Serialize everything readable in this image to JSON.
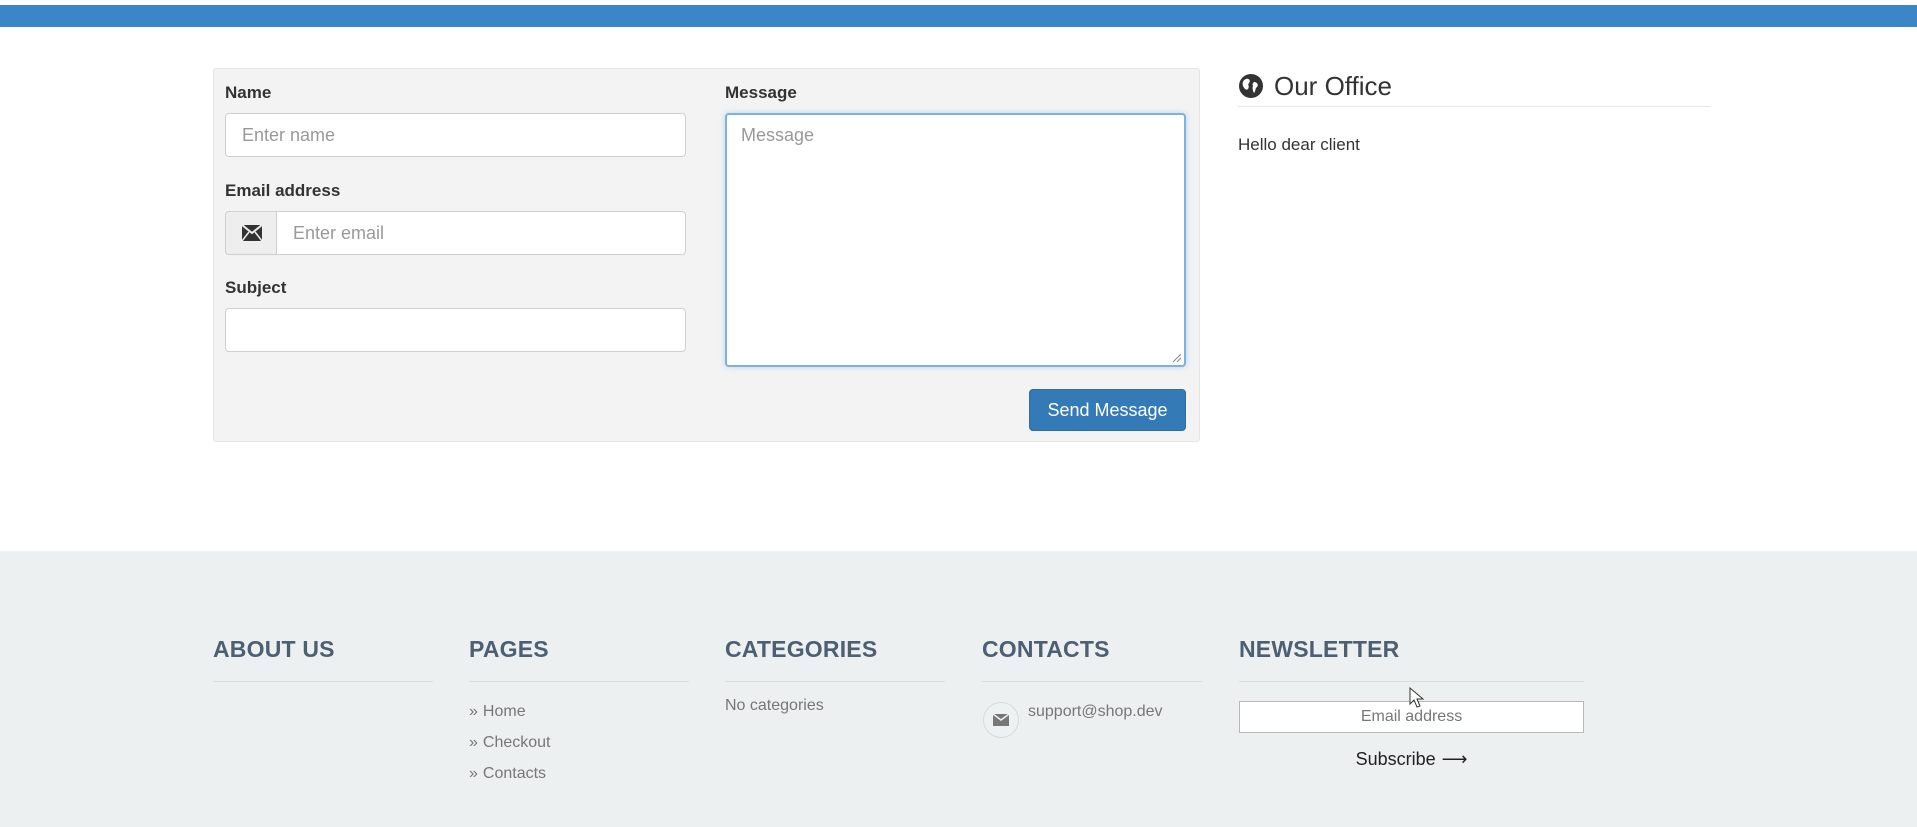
{
  "colors": {
    "top_strip": "#3a86c6",
    "primary_button": "#337ab7",
    "footer_bg": "#edf0f1",
    "footer_heading": "#4d5f73"
  },
  "contact_form": {
    "name_label": "Name",
    "name_placeholder": "Enter name",
    "email_label": "Email address",
    "email_placeholder": "Enter email",
    "email_icon": "envelope-icon",
    "subject_label": "Subject",
    "subject_value": "",
    "message_label": "Message",
    "message_placeholder": "Message",
    "send_label": "Send Message"
  },
  "office": {
    "icon": "globe-icon",
    "title": "Our Office",
    "text": "Hello dear client"
  },
  "footer": {
    "about": {
      "heading": "ABOUT US"
    },
    "pages": {
      "heading": "PAGES",
      "items": [
        {
          "bullet": "»",
          "label": "Home"
        },
        {
          "bullet": "»",
          "label": "Checkout"
        },
        {
          "bullet": "»",
          "label": "Contacts"
        }
      ]
    },
    "categories": {
      "heading": "CATEGORIES",
      "empty_text": "No categories"
    },
    "contacts": {
      "heading": "CONTACTS",
      "email": "support@shop.dev",
      "icon": "envelope-icon"
    },
    "newsletter": {
      "heading": "NEWSLETTER",
      "email_placeholder": "Email address",
      "subscribe_label": "Subscribe",
      "subscribe_arrow": "⟶"
    }
  }
}
